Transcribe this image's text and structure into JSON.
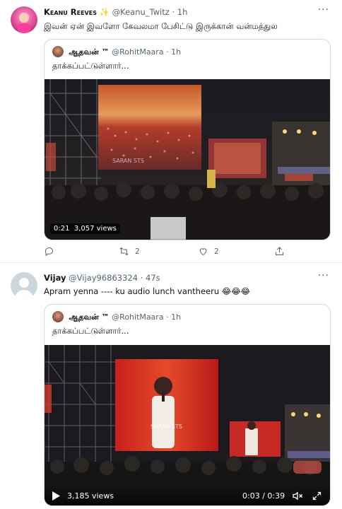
{
  "tweet1": {
    "author_name": "Keanu Reeves",
    "badge_emoji": "✨",
    "handle": "@Keanu_Twitz",
    "separator": "·",
    "time": "1h",
    "text": "இவன் ஏன் இவளோ கேவலமா பேசிட்டு இருக்கான் வன்மத்துல",
    "quote": {
      "author_name": "ஆதவன் ™",
      "handle": "@RohitMaara",
      "separator": "·",
      "time": "1h",
      "text": "தாக்கப்பட்டுள்ளார்...",
      "video_watermark": "SARAN STS",
      "duration": "0:21",
      "views": "3,057 views"
    },
    "actions": {
      "reply_count": "",
      "retweet_count": "2",
      "like_count": "2"
    }
  },
  "tweet2": {
    "author_name": "Vijay",
    "handle": "@Vijay96863324",
    "separator": "·",
    "time": "47s",
    "text": "Apram yenna ---- ku audio lunch vantheeru 😂😂😂",
    "quote": {
      "author_name": "ஆதவன் ™",
      "handle": "@RohitMaara",
      "separator": "·",
      "time": "1h",
      "text": "தாக்கப்பட்டுள்ளார்...",
      "video_watermark": "SARAN STS",
      "views": "3,185 views",
      "progress": "0:03 / 0:39",
      "progress_fraction": 0.077
    }
  },
  "icons": {
    "more": "more-dots-icon",
    "reply": "reply-icon",
    "retweet": "retweet-icon",
    "like": "heart-icon",
    "share": "share-icon",
    "play": "play-icon",
    "mute": "mute-icon",
    "fullscreen": "fullscreen-icon"
  },
  "colors": {
    "accent": "#1d9bf0",
    "text": "#0f1419",
    "muted": "#536471",
    "border": "#cfd9de"
  }
}
